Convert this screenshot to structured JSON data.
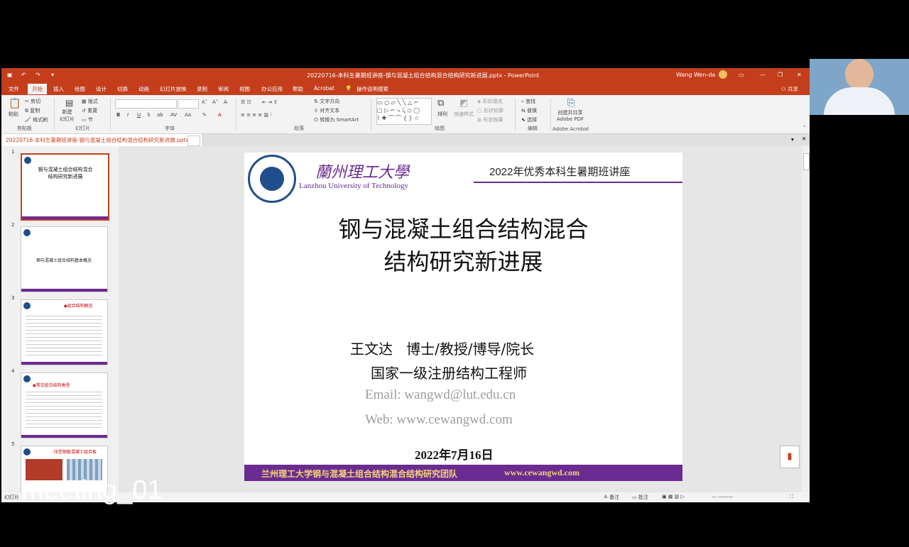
{
  "window": {
    "title": "20220716-本科生暑期班讲座-钢与混凝土组合结构混合结构研究新进展.pptx - PowerPoint",
    "user": "Wang Wen-da",
    "share_label": "共享"
  },
  "ribbon_tabs": [
    "文件",
    "开始",
    "插入",
    "绘图",
    "设计",
    "切换",
    "动画",
    "幻灯片放映",
    "录制",
    "审阅",
    "视图",
    "办公应用",
    "帮助",
    "Acrobat",
    "操作说明搜索"
  ],
  "ribbon": {
    "clipboard": {
      "paste": "粘贴",
      "cut": "剪切",
      "copy": "复制",
      "format_painter": "格式刷",
      "group": "剪贴板"
    },
    "slides": {
      "new_slide": "新建\n幻灯片",
      "layout": "版式",
      "reset": "重置",
      "section": "节",
      "group": "幻灯片"
    },
    "font": {
      "group": "字体"
    },
    "paragraph": {
      "text_direction": "文字方向",
      "align_text": "对齐文本",
      "smartart": "转换为 SmartArt",
      "group": "段落"
    },
    "drawing": {
      "arrange": "排列",
      "quick_styles": "快速样式",
      "fill": "形状填充",
      "outline": "形状轮廓",
      "effects": "形状效果",
      "group": "绘图"
    },
    "editing": {
      "find": "查找",
      "replace": "替换",
      "select": "选择",
      "group": "编辑"
    },
    "acrobat": {
      "create_share": "创建并共享\nAdobe PDF",
      "group": "Adobe Acrobat"
    }
  },
  "doc_tab": "20220716-本科生暑期班讲座-钢与混凝土组合结构混合结构研究新进展.pptx",
  "thumbnails": [
    {
      "num": "1",
      "title": "钢与混凝土组合结构混合结构研究新进展"
    },
    {
      "num": "2",
      "title": "钢与混凝土组合结构基本概念"
    },
    {
      "num": "3",
      "title": "◆组合结构概念"
    },
    {
      "num": "4",
      "title": "◆常见组合结构类型"
    },
    {
      "num": "5",
      "title": "压型钢板混凝土组合板"
    }
  ],
  "slide": {
    "uni_cn": "蘭州理工大學",
    "uni_en": "Lanzhou University of Technology",
    "lecture": "2022年优秀本科生暑期班讲座",
    "title_line1": "钢与混凝土组合结构混合",
    "title_line2": "结构研究新进展",
    "author": "王文达   博士/教授/博导/院长",
    "cert": "国家一级注册结构工程师",
    "email": "Email: wangwd@lut.edu.cn",
    "web": "Web: www.cewangwd.com",
    "date": "2022年7月16日",
    "footer_left": "兰州理工大学钢与混凝土组合结构混合结构研究团队",
    "footer_right": "www.cewangwd.com"
  },
  "status": {
    "slide": "幻灯片",
    "notes": "备注",
    "comments": "批注"
  },
  "overlay": {
    "meeting_label": "meeting_01"
  },
  "colors": {
    "accent": "#c43e1c",
    "purple": "#6a2c90",
    "navy": "#1e4e8c"
  }
}
